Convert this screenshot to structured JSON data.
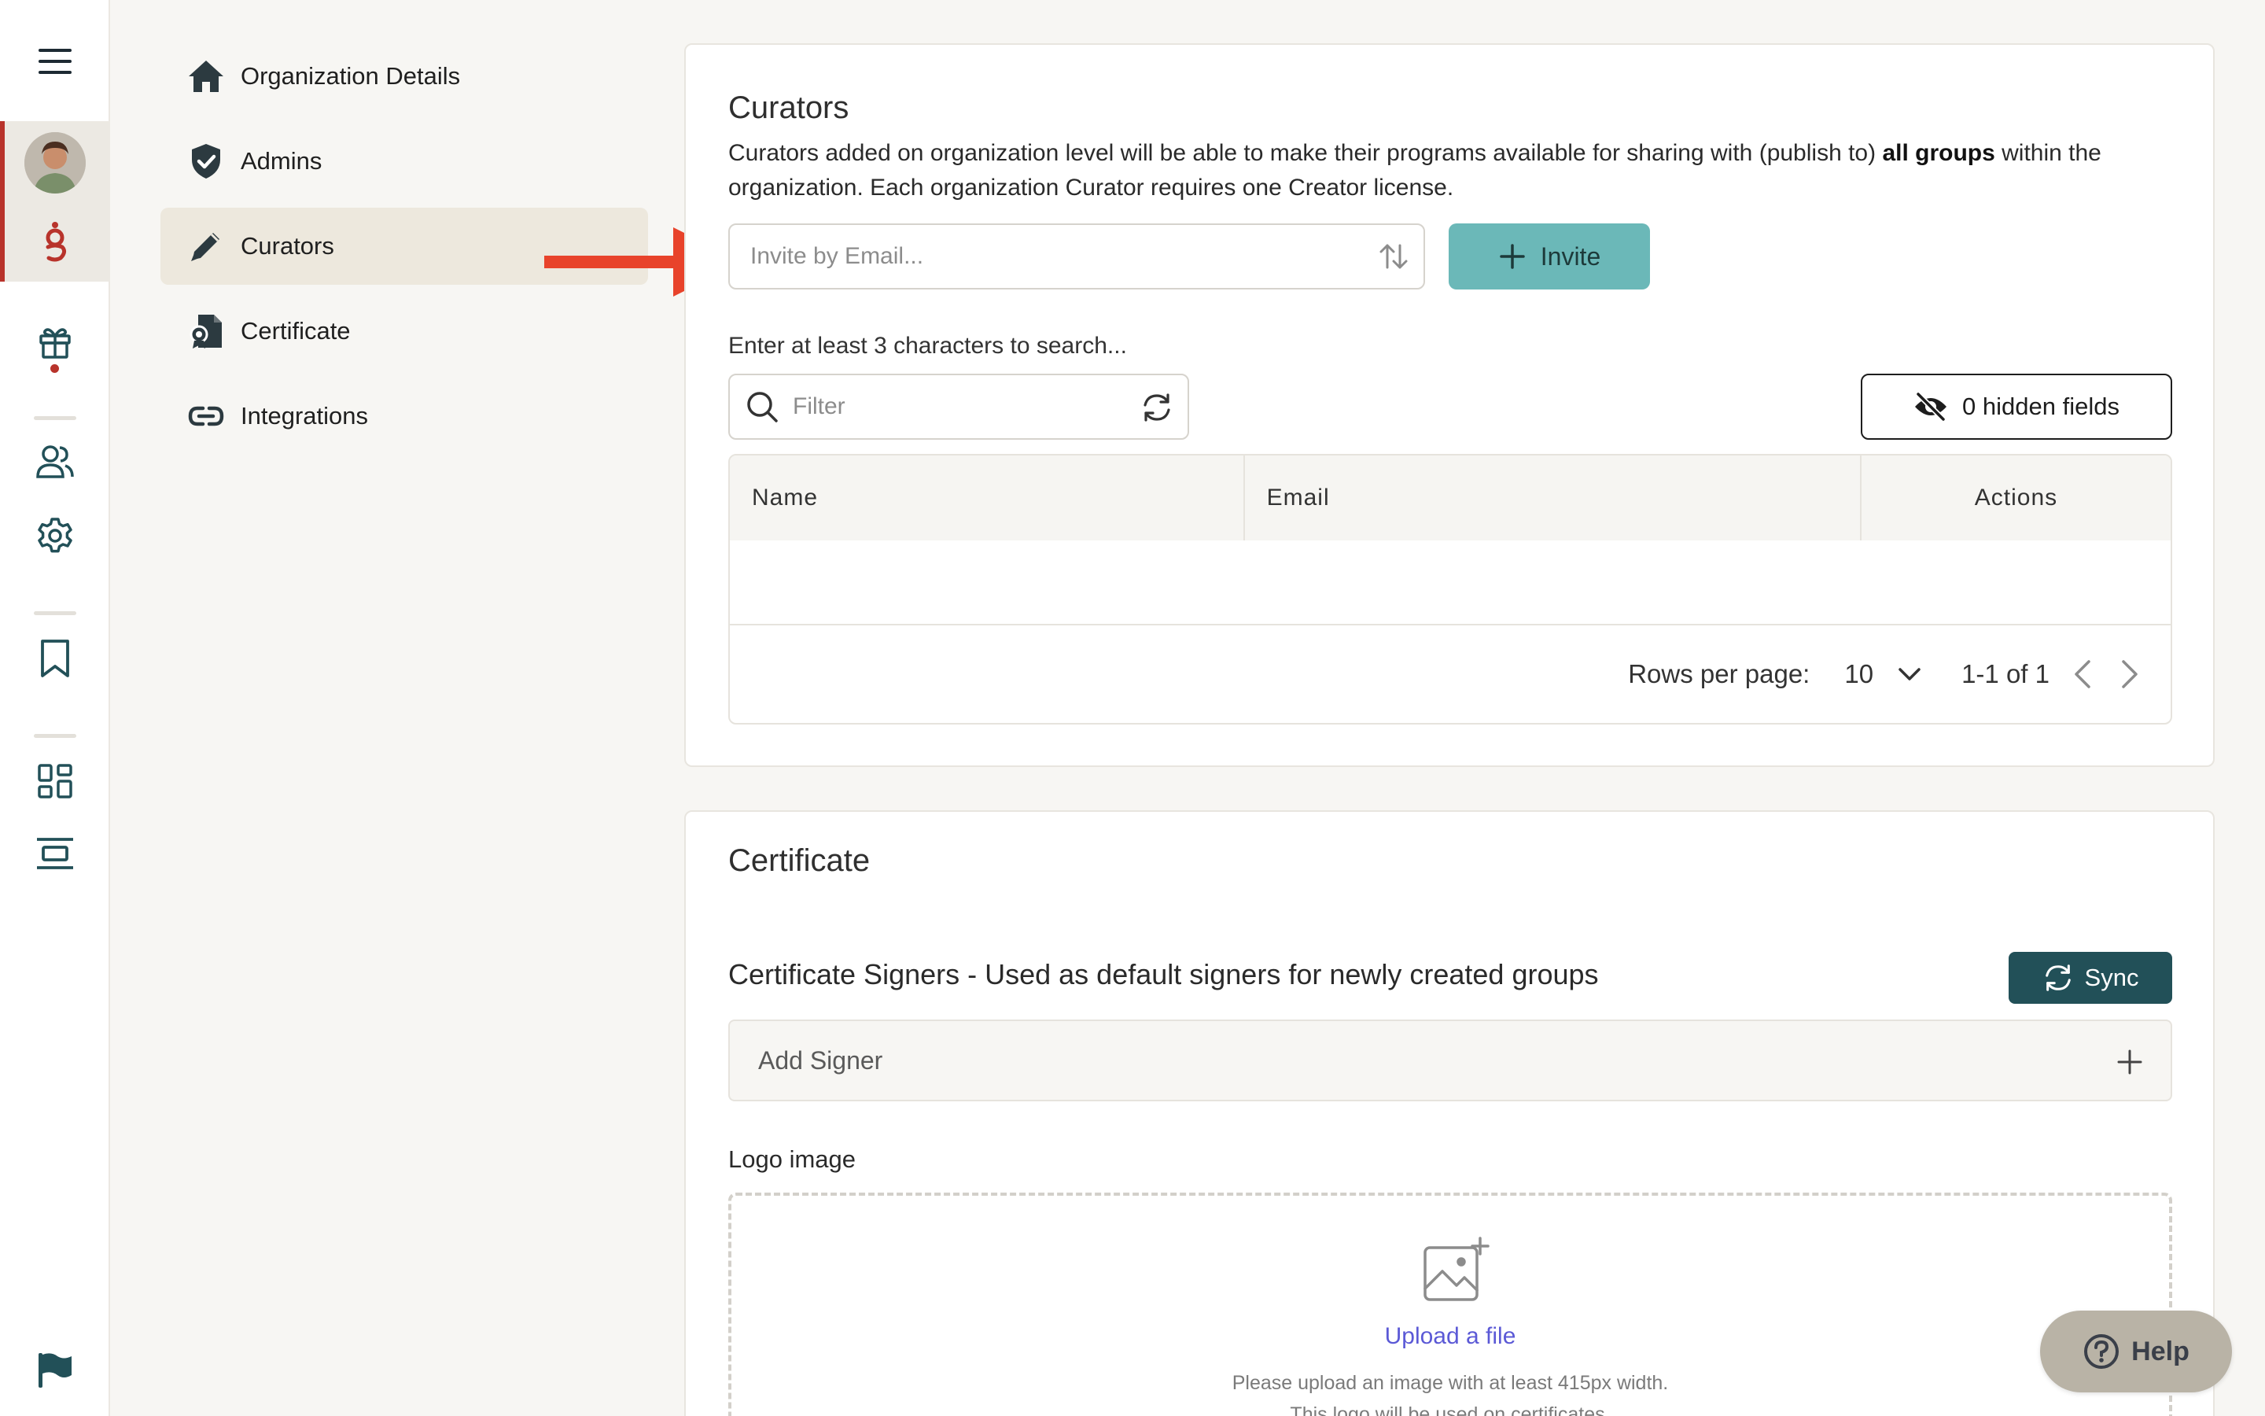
{
  "rail": {
    "items": [
      "menu",
      "profile",
      "logo",
      "gifts",
      "people",
      "settings",
      "bookmarks",
      "dashboard",
      "layout",
      "flag"
    ]
  },
  "nav": {
    "items": [
      {
        "label": "Organization Details",
        "icon": "home-icon"
      },
      {
        "label": "Admins",
        "icon": "shield-icon"
      },
      {
        "label": "Curators",
        "icon": "pencil-icon"
      },
      {
        "label": "Certificate",
        "icon": "certificate-icon"
      },
      {
        "label": "Integrations",
        "icon": "link-icon"
      }
    ],
    "active": "Curators"
  },
  "curators": {
    "title": "Curators",
    "description_pre": "Curators added on organization level will be able to make their programs available for sharing with (publish to) ",
    "description_bold": "all groups",
    "description_post": " within the organization. Each organization Curator requires one Creator license.",
    "invite_placeholder": "Invite by Email...",
    "invite_label": "Invite",
    "search_hint": "Enter at least 3 characters to search...",
    "filter_placeholder": "Filter",
    "hidden_fields_label": "0 hidden fields",
    "table": {
      "columns": [
        "Name",
        "Email",
        "Actions"
      ],
      "rows": []
    },
    "pager": {
      "rows_per_page_label": "Rows per page:",
      "rows_per_page_value": "10",
      "range": "1-1 of 1"
    }
  },
  "certificate": {
    "title": "Certificate",
    "signers_label": "Certificate Signers - Used as default signers for newly created groups",
    "sync_label": "Sync",
    "add_signer_label": "Add Signer",
    "logo_label": "Logo image",
    "upload_link": "Upload a file",
    "upload_hint_1": "Please upload an image with at least 415px width.",
    "upload_hint_2": "This logo will be used on certificates."
  },
  "help": {
    "label": "Help"
  },
  "colors": {
    "accent_teal": "#6bb8b8",
    "dark_teal": "#225058",
    "brand_red": "#b8332b",
    "link_purple": "#5b59d6"
  }
}
